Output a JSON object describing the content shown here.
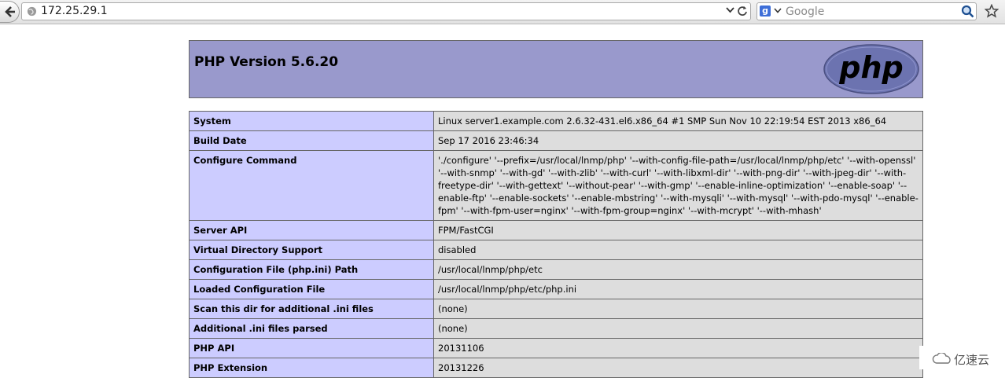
{
  "browser": {
    "url": "172.25.29.1",
    "search_placeholder": "Google",
    "search_engine_letter": "g"
  },
  "page": {
    "title": "PHP Version 5.6.20",
    "logo_text": "php",
    "rows": [
      {
        "key": "System",
        "value": "Linux server1.example.com 2.6.32-431.el6.x86_64 #1 SMP Sun Nov 10 22:19:54 EST 2013 x86_64"
      },
      {
        "key": "Build Date",
        "value": "Sep 17 2016 23:46:34"
      },
      {
        "key": "Configure Command",
        "value": "'./configure' '--prefix=/usr/local/lnmp/php' '--with-config-file-path=/usr/local/lnmp/php/etc' '--with-openssl' '--with-snmp' '--with-gd' '--with-zlib' '--with-curl' '--with-libxml-dir' '--with-png-dir' '--with-jpeg-dir' '--with-freetype-dir' '--with-gettext' '--without-pear' '--with-gmp' '--enable-inline-optimization' '--enable-soap' '--enable-ftp' '--enable-sockets' '--enable-mbstring' '--with-mysqli' '--with-mysql' '--with-pdo-mysql' '--enable-fpm' '--with-fpm-user=nginx' '--with-fpm-group=nginx' '--with-mcrypt' '--with-mhash'"
      },
      {
        "key": "Server API",
        "value": "FPM/FastCGI"
      },
      {
        "key": "Virtual Directory Support",
        "value": "disabled"
      },
      {
        "key": "Configuration File (php.ini) Path",
        "value": "/usr/local/lnmp/php/etc"
      },
      {
        "key": "Loaded Configuration File",
        "value": "/usr/local/lnmp/php/etc/php.ini"
      },
      {
        "key": "Scan this dir for additional .ini files",
        "value": "(none)"
      },
      {
        "key": "Additional .ini files parsed",
        "value": "(none)"
      },
      {
        "key": "PHP API",
        "value": "20131106"
      },
      {
        "key": "PHP Extension",
        "value": "20131226"
      }
    ]
  },
  "watermark": {
    "text": "亿速云"
  },
  "colors": {
    "header_bg": "#9999cc",
    "key_bg": "#ccccff",
    "value_bg": "#dddddd",
    "logo_bg": "#6c73b0"
  }
}
